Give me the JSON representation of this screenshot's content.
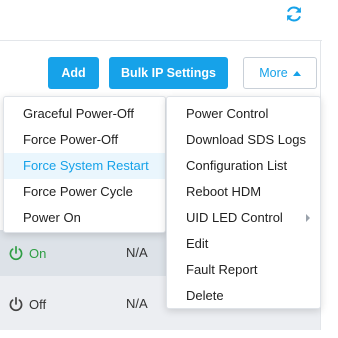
{
  "header": {
    "refresh_icon": "refresh-icon"
  },
  "toolbar": {
    "add_label": "Add",
    "bulk_label": "Bulk IP Settings",
    "more_label": "More"
  },
  "power_menu": {
    "items": [
      {
        "label": "Graceful Power-Off"
      },
      {
        "label": "Force Power-Off"
      },
      {
        "label": "Force System Restart",
        "highlighted": true
      },
      {
        "label": "Force Power Cycle"
      },
      {
        "label": "Power On"
      }
    ]
  },
  "more_menu": {
    "items": [
      {
        "label": "Power Control"
      },
      {
        "label": "Download SDS Logs"
      },
      {
        "label": "Configuration List"
      },
      {
        "label": "Reboot HDM"
      },
      {
        "label": "UID LED Control",
        "has_submenu": true
      },
      {
        "label": "Edit"
      },
      {
        "label": "Fault Report"
      },
      {
        "label": "Delete"
      }
    ]
  },
  "table": {
    "rows": [
      {
        "status": "On",
        "value": "N/A"
      },
      {
        "status": "Off",
        "value": "N/A"
      }
    ]
  },
  "colors": {
    "accent": "#16a2e9",
    "status_on": "#2f9e44",
    "status_off": "#333333"
  }
}
